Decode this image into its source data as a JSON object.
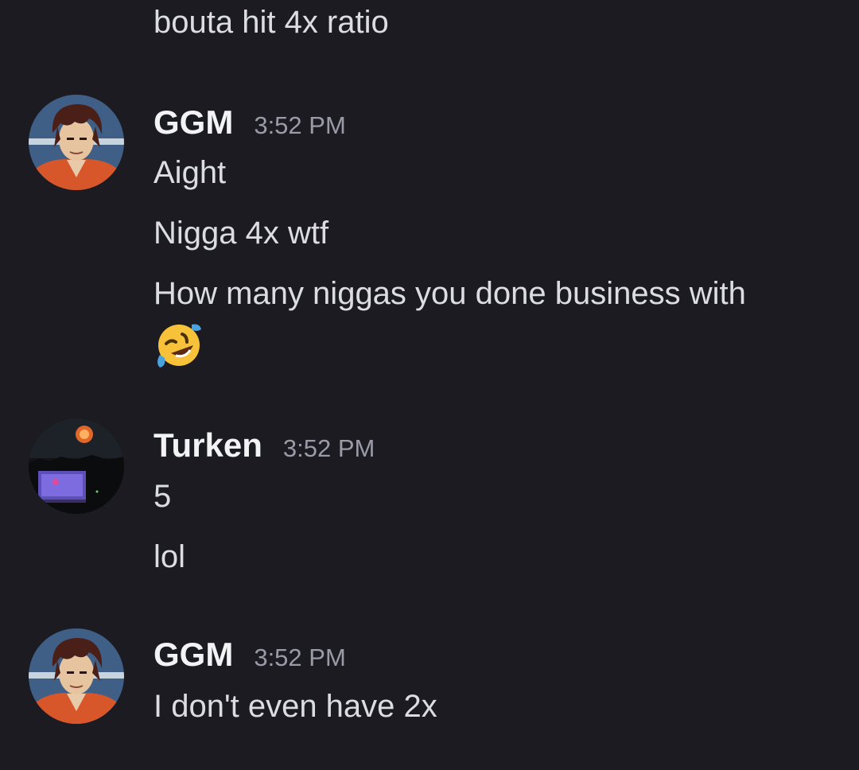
{
  "messages": [
    {
      "continuation": "bouta hit 4x ratio"
    },
    {
      "author": "GGM",
      "timestamp": "3:52 PM",
      "lines": [
        "Aight",
        "Nigga 4x wtf",
        "How many niggas you done business with"
      ],
      "emoji": "rolling-on-floor-laughing"
    },
    {
      "author": "Turken",
      "timestamp": "3:52 PM",
      "lines": [
        "5",
        "lol"
      ]
    },
    {
      "author": "GGM",
      "timestamp": "3:52 PM",
      "lines": [
        "I don't even have 2x"
      ]
    }
  ],
  "colors": {
    "background": "#1b1b21",
    "text": "#dcdde3",
    "author": "#f2f3f5",
    "timestamp": "#9a9ba6"
  }
}
